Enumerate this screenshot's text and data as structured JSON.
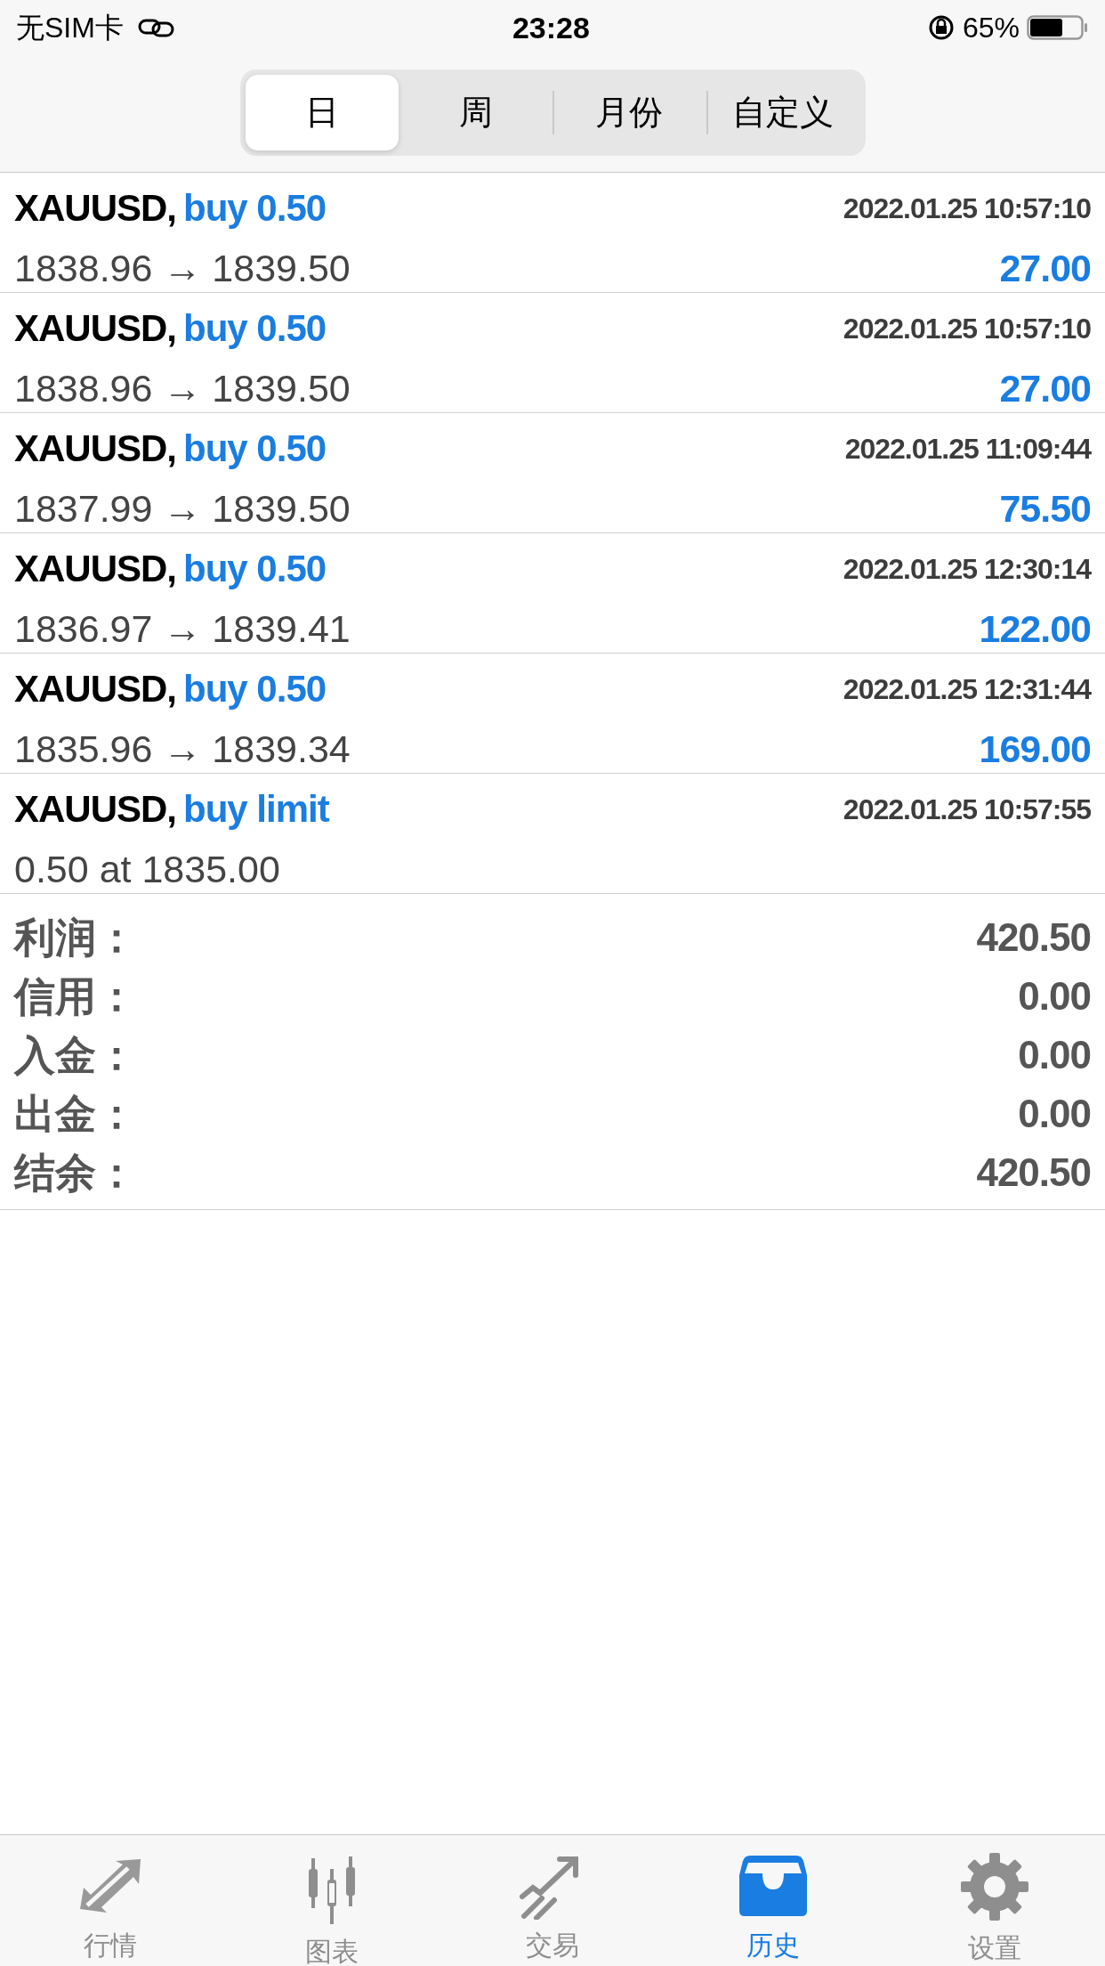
{
  "status_bar": {
    "carrier": "无SIM卡",
    "time": "23:28",
    "battery": "65%"
  },
  "segments": [
    {
      "label": "日",
      "selected": true
    },
    {
      "label": "周",
      "selected": false
    },
    {
      "label": "月份",
      "selected": false
    },
    {
      "label": "自定义",
      "selected": false
    }
  ],
  "trades": [
    {
      "symbol": "XAUUSD,",
      "type": "buy 0.50",
      "time": "2022.01.25 10:57:10",
      "prices": "1838.96 → 1839.50",
      "profit": "27.00"
    },
    {
      "symbol": "XAUUSD,",
      "type": "buy 0.50",
      "time": "2022.01.25 10:57:10",
      "prices": "1838.96 → 1839.50",
      "profit": "27.00"
    },
    {
      "symbol": "XAUUSD,",
      "type": "buy 0.50",
      "time": "2022.01.25 11:09:44",
      "prices": "1837.99 → 1839.50",
      "profit": "75.50"
    },
    {
      "symbol": "XAUUSD,",
      "type": "buy 0.50",
      "time": "2022.01.25 12:30:14",
      "prices": "1836.97 → 1839.41",
      "profit": "122.00"
    },
    {
      "symbol": "XAUUSD,",
      "type": "buy 0.50",
      "time": "2022.01.25 12:31:44",
      "prices": "1835.96 → 1839.34",
      "profit": "169.00"
    },
    {
      "symbol": "XAUUSD,",
      "type": "buy limit",
      "time": "2022.01.25 10:57:55",
      "prices": "0.50 at 1835.00"
    }
  ],
  "summary": [
    {
      "label": "利润：",
      "value": "420.50"
    },
    {
      "label": "信用：",
      "value": "0.00"
    },
    {
      "label": "入金：",
      "value": "0.00"
    },
    {
      "label": "出金：",
      "value": "0.00"
    },
    {
      "label": "结余：",
      "value": "420.50"
    }
  ],
  "tab_bar": [
    {
      "label": "行情",
      "selected": false
    },
    {
      "label": "图表",
      "selected": false
    },
    {
      "label": "交易",
      "selected": false
    },
    {
      "label": "历史",
      "selected": true
    },
    {
      "label": "设置",
      "selected": false
    }
  ]
}
